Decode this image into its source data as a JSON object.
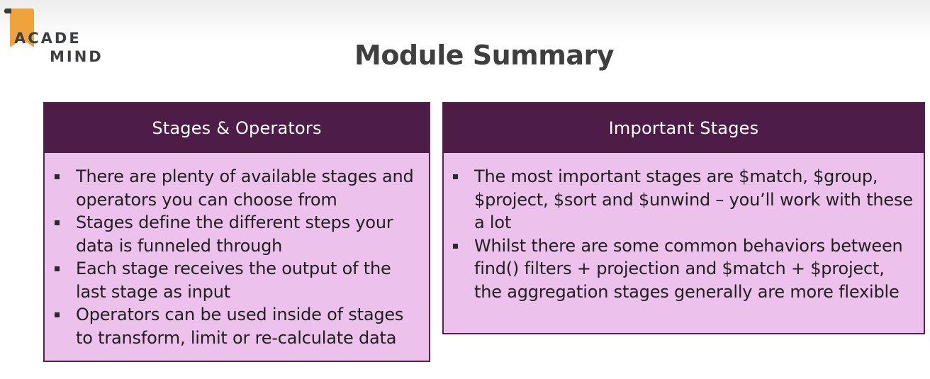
{
  "logo": {
    "line1": "ACADE",
    "line2": "MIND"
  },
  "title": "Module Summary",
  "panels": [
    {
      "header": "Stages & Operators",
      "bullets": [
        "There are plenty of available stages and operators you can choose from",
        "Stages define the different steps your data is funneled through",
        "Each stage receives the output of the last stage as input",
        "Operators can be used inside of stages to transform, limit or re-calculate data"
      ]
    },
    {
      "header": "Important Stages",
      "bullets": [
        "The most important stages are $match, $group, $project, $sort and $unwind – you’ll work with these a lot",
        "Whilst there are some common behaviors between find() filters + projection and $match + $project, the aggregation stages generally are more flexible"
      ]
    }
  ],
  "colors": {
    "header_bg": "#4e1d47",
    "panel_bg": "#ecc1ec",
    "logo_accent": "#f0a23b",
    "title_text": "#3f3f3f"
  }
}
